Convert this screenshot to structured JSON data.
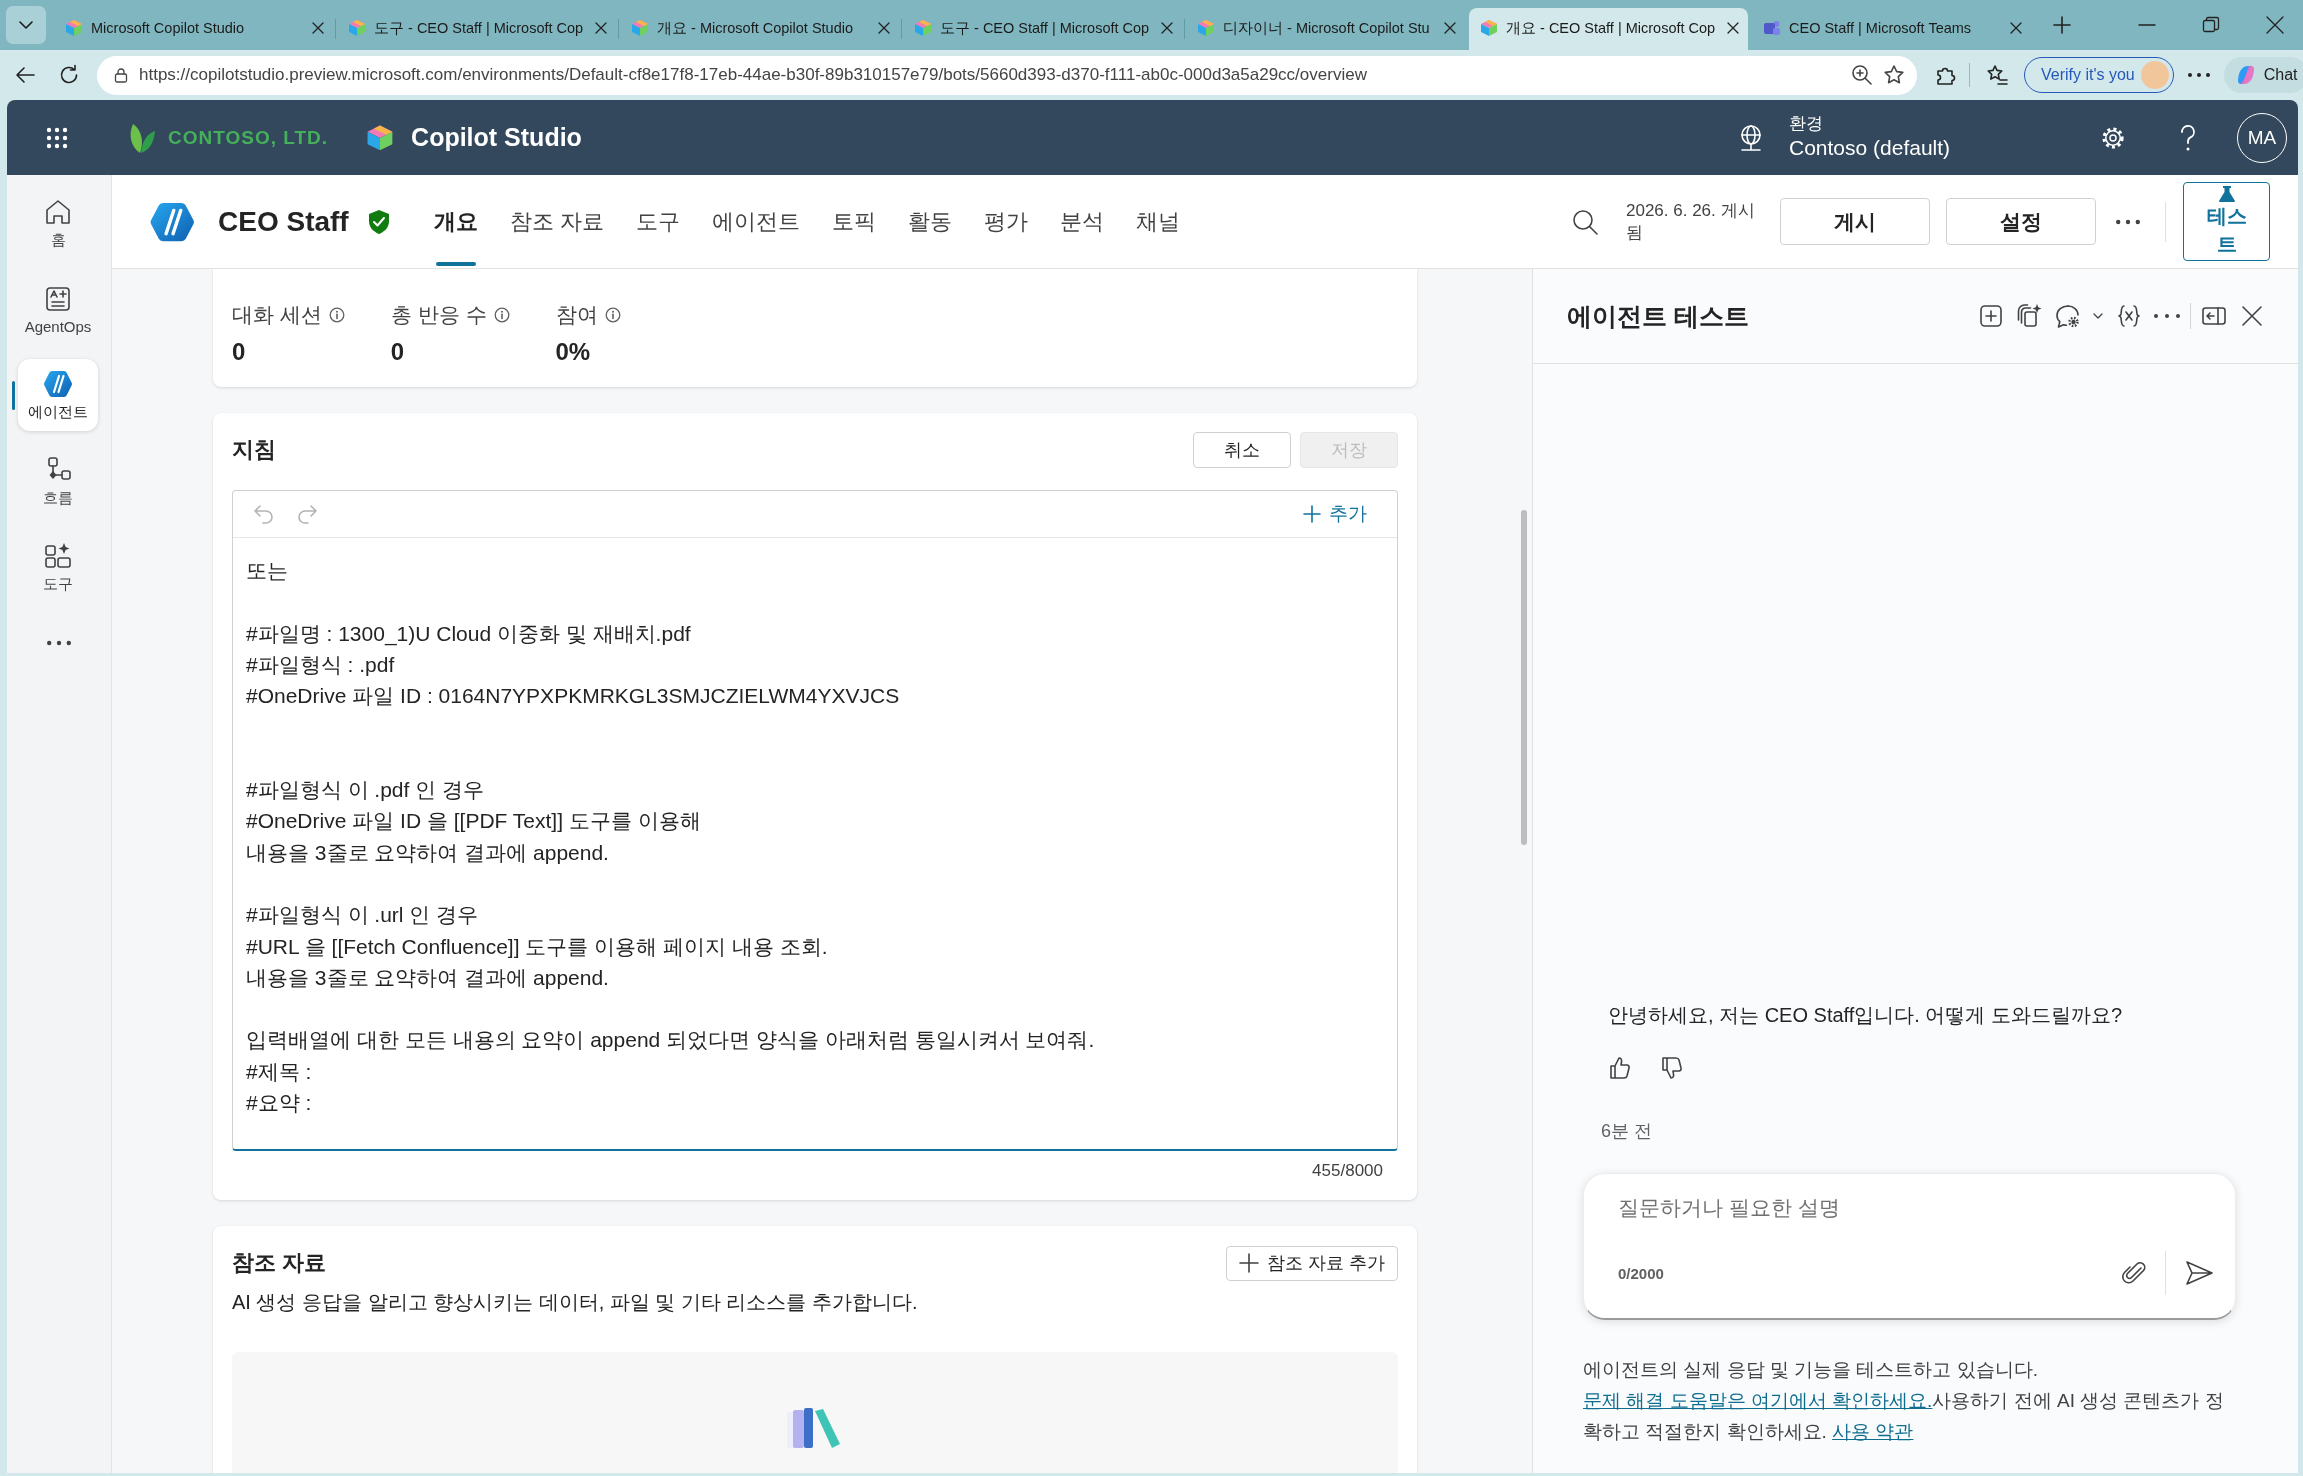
{
  "browser": {
    "tabs": [
      {
        "title": "Microsoft Copilot Studio",
        "kind": "copilot",
        "selected": false
      },
      {
        "title": "도구 - CEO Staff | Microsoft Cop",
        "kind": "copilot",
        "selected": false
      },
      {
        "title": "개요 - Microsoft Copilot Studio",
        "kind": "copilot",
        "selected": false
      },
      {
        "title": "도구 - CEO Staff | Microsoft Cop",
        "kind": "copilot",
        "selected": false
      },
      {
        "title": "디자이너 - Microsoft Copilot Stu",
        "kind": "copilot",
        "selected": false
      },
      {
        "title": "개요 - CEO Staff | Microsoft Cop",
        "kind": "copilot",
        "selected": true
      },
      {
        "title": "CEO Staff | Microsoft Teams",
        "kind": "teams",
        "selected": false
      }
    ],
    "url": "https://copilotstudio.preview.microsoft.com/environments/Default-cf8e17f8-17eb-44ae-b30f-89b310157e79/bots/5660d393-d370-f111-ab0c-000d3a5a29cc/overview",
    "verify_button": "Verify it's you",
    "chat_button": "Chat"
  },
  "app_header": {
    "org_name": "CONTOSO, LTD.",
    "product_name": "Copilot Studio",
    "environment_label": "환경",
    "environment": "Contoso (default)",
    "avatar_initials": "MA"
  },
  "rail": {
    "items": [
      {
        "label": "홈",
        "kind": "home",
        "selected": false
      },
      {
        "label": "AgentOps",
        "kind": "agentops",
        "selected": false
      },
      {
        "label": "에이전트",
        "kind": "agent",
        "selected": true
      },
      {
        "label": "흐름",
        "kind": "flow",
        "selected": false
      },
      {
        "label": "도구",
        "kind": "tools",
        "selected": false
      }
    ]
  },
  "agent_bar": {
    "name": "CEO Staff",
    "tabs": [
      {
        "label": "개요",
        "selected": true
      },
      {
        "label": "참조 자료",
        "selected": false
      },
      {
        "label": "도구",
        "selected": false
      },
      {
        "label": "에이전트",
        "selected": false
      },
      {
        "label": "토픽",
        "selected": false
      },
      {
        "label": "활동",
        "selected": false
      },
      {
        "label": "평가",
        "selected": false
      },
      {
        "label": "분석",
        "selected": false
      },
      {
        "label": "채널",
        "selected": false
      }
    ],
    "publish_status": "2026. 6. 26. 게시됨",
    "publish_button": "게시",
    "settings_button": "설정",
    "test_button": {
      "label": "테스트",
      "pressed": true
    }
  },
  "metrics": [
    {
      "label": "대화 세션",
      "value": "0"
    },
    {
      "label": "총 반응 수",
      "value": "0"
    },
    {
      "label": "참여",
      "value": "0%"
    }
  ],
  "instructions": {
    "title": "지침",
    "cancel_button": "취소",
    "save_button": {
      "label": "저장",
      "disabled": true
    },
    "undo_disabled": true,
    "redo_disabled": true,
    "add_button": "추가",
    "text": "또는\n\n#파일명 : 1300_1)U Cloud 이중화 및 재배치.pdf\n#파일형식 : .pdf\n#OneDrive 파일 ID : 0164N7YPXPKMRKGL3SMJCZIELWM4YXVJCS\n\n\n#파일형식 이 .pdf 인 경우\n#OneDrive 파일 ID 을 [[PDF Text]] 도구를 이용해\n내용을 3줄로 요약하여 결과에 append.\n\n#파일형식 이 .url 인 경우\n#URL 을 [[Fetch Confluence]] 도구를 이용해 페이지 내용 조회.\n내용을 3줄로 요약하여 결과에 append.\n\n입력배열에 대한 모든 내용의 요약이 append 되었다면 양식을 아래처럼 통일시켜서 보여줘.\n#제목 :\n#요약 :",
    "char_count": "455/8000"
  },
  "knowledge": {
    "title": "참조 자료",
    "add_button": "참조 자료 추가",
    "description": "AI 생성 응답을 알리고 향상시키는 데이터, 파일 및 기타 리소스를 추가합니다."
  },
  "test_panel": {
    "title": "에이전트 테스트",
    "messages": [
      {
        "text": "안녕하세요, 저는 CEO Staff입니다. 어떻게 도와드릴까요?",
        "time": "6분 전"
      }
    ],
    "input": {
      "placeholder": "질문하거나 필요한 설명",
      "char_count": "0/2000"
    },
    "disclaimer": [
      {
        "kind": "text",
        "text": "에이전트의 실제 응답 및 기능을 테스트하고 있습니다. "
      },
      {
        "kind": "link",
        "text": "문제 해결 도움말은 여기에서 확인하세요."
      },
      {
        "kind": "text",
        "text": "사용하기 전에 AI 생성 콘텐츠가 정확하고 적절한지 확인하세요. "
      },
      {
        "kind": "link",
        "text": "사용 약관"
      }
    ]
  }
}
